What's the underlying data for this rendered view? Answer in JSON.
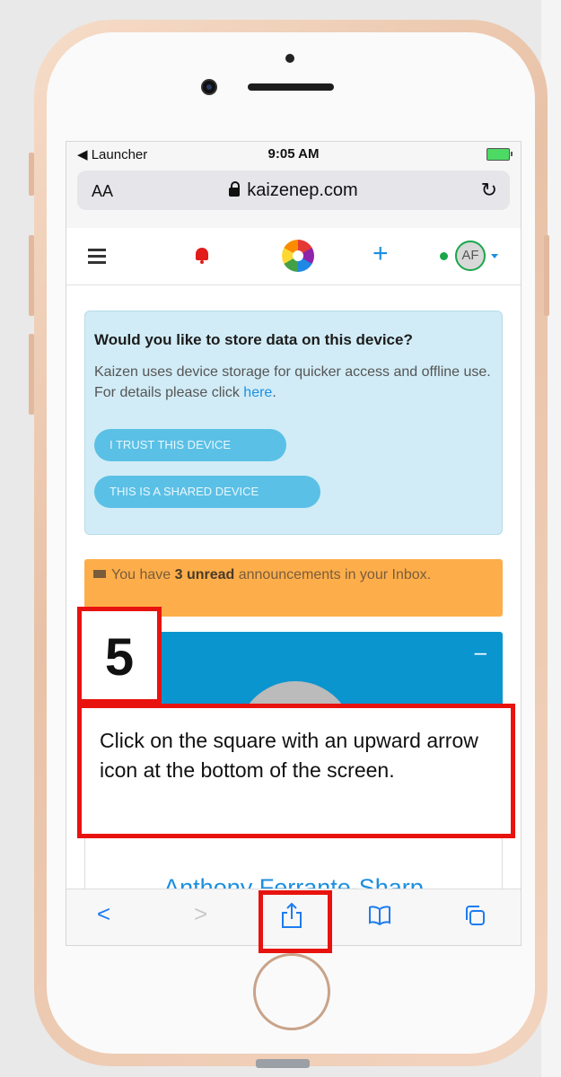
{
  "status_bar": {
    "back_label": "◀ Launcher",
    "time": "9:05 AM"
  },
  "browser": {
    "text_size_label": "AA",
    "domain": "kaizenep.com",
    "reload_icon": "reload-icon"
  },
  "app_nav": {
    "menu_icon": "hamburger-icon",
    "notification_icon": "bell-icon",
    "logo_icon": "kaizen-logo",
    "add_icon": "plus-icon",
    "avatar_initials": "AF"
  },
  "storage_prompt": {
    "title": "Would you like to store data on this device?",
    "body": "Kaizen uses device storage for quicker access and offline use. For details please click ",
    "link_text": "here",
    "body_end": ".",
    "trust_button": "I TRUST THIS DEVICE",
    "shared_button": "THIS IS A SHARED DEVICE"
  },
  "inbox_alert": {
    "prefix": "You have ",
    "count_text": "3 unread",
    "suffix": " announcements in your Inbox."
  },
  "profile": {
    "collapse_label": "–",
    "name": "Anthony Ferrante-Sharp"
  },
  "tutorial": {
    "step_number": "5",
    "instruction": "Click on the square with an upward arrow icon at the bottom of the screen."
  },
  "toolbar": {
    "back_label": "<",
    "forward_label": ">",
    "share_icon": "share-icon",
    "bookmarks_icon": "book-icon",
    "tabs_icon": "tabs-icon"
  },
  "colors": {
    "accent_blue": "#1d8fe0",
    "alert_info_bg": "#d1ecf6",
    "alert_warning_bg": "#fdae4a",
    "highlight_red": "#e8130f"
  }
}
